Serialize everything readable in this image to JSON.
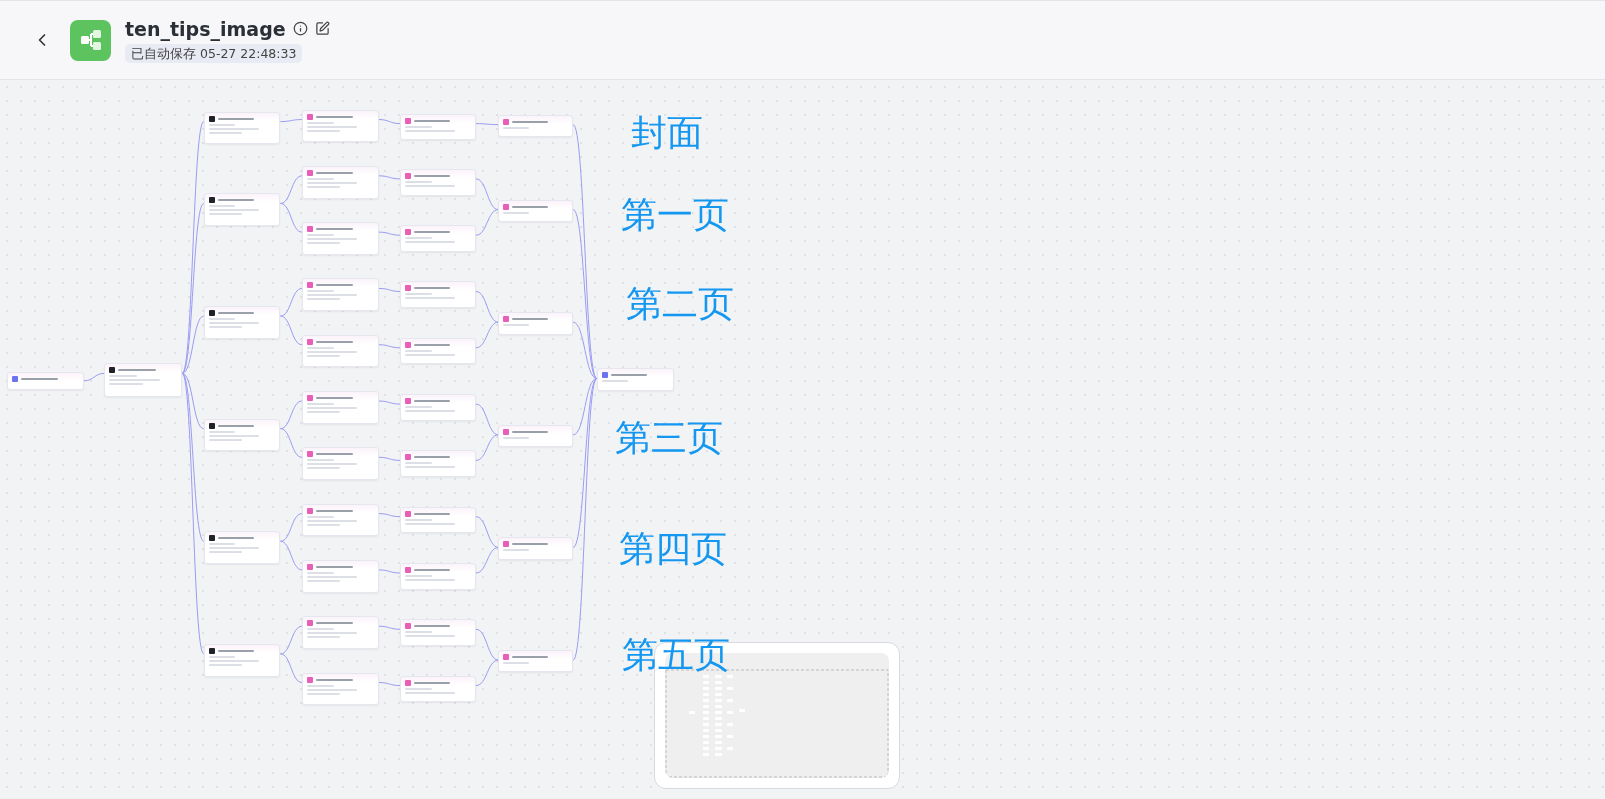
{
  "header": {
    "title": "ten_tips_image",
    "save_status": "已自动保存 05-27 22:48:33"
  },
  "canvas": {
    "labels": [
      "封面",
      "第一页",
      "第二页",
      "第三页",
      "第四页",
      "第五页"
    ]
  }
}
